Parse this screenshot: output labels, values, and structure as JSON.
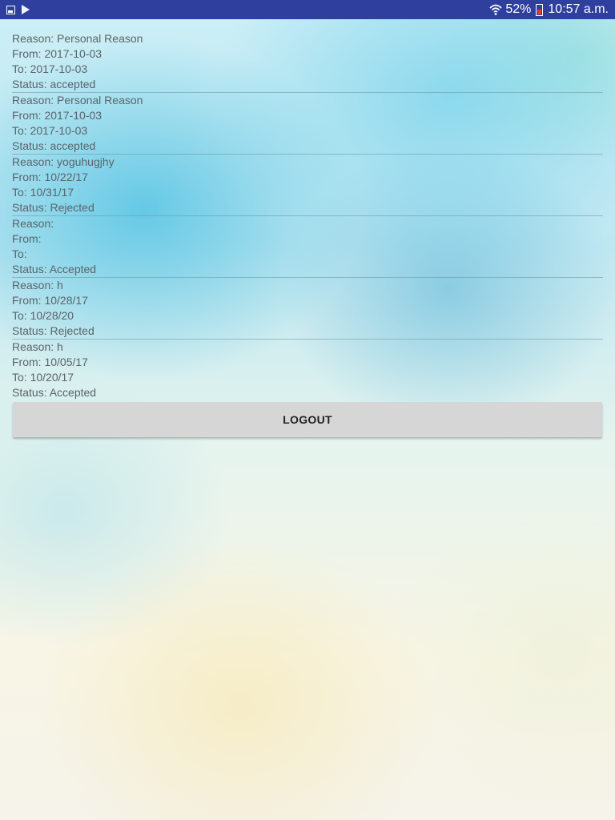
{
  "status_bar": {
    "battery_percent": "52%",
    "time": "10:57 a.m.",
    "icons": [
      "gallery-icon",
      "play-store-icon",
      "wifi-icon",
      "battery-icon"
    ],
    "color": "#2f3f9e"
  },
  "leaves": [
    {
      "reason": "Reason: Personal Reason",
      "from": "From: 2017-10-03",
      "to": "To: 2017-10-03",
      "status": "Status: accepted"
    },
    {
      "reason": "Reason: Personal Reason",
      "from": "From: 2017-10-03",
      "to": "To: 2017-10-03",
      "status": "Status: accepted"
    },
    {
      "reason": "Reason: yoguhugjhy",
      "from": "From: 10/22/17",
      "to": "To: 10/31/17",
      "status": "Status: Rejected"
    },
    {
      "reason": "Reason:",
      "from": "From:",
      "to": "To:",
      "status": "Status: Accepted"
    },
    {
      "reason": "Reason: h",
      "from": "From: 10/28/17",
      "to": "To: 10/28/20",
      "status": "Status: Rejected"
    },
    {
      "reason": "Reason: h",
      "from": "From: 10/05/17",
      "to": "To: 10/20/17",
      "status": "Status: Accepted"
    }
  ],
  "logout_label": "LOGOUT"
}
